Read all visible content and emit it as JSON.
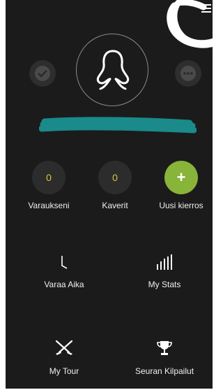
{
  "app": {
    "menu_icon": "hamburger-menu-icon"
  },
  "profile": {
    "left_icon": "check-chat-icon",
    "avatar_icon": "user-silhouette-icon",
    "right_icon": "more-chat-icon",
    "name_redaction": "teal-scribble"
  },
  "counters": [
    {
      "value": "0",
      "label": "Varaukseni"
    },
    {
      "value": "0",
      "label": "Kaverit"
    },
    {
      "value": "+",
      "label": "Uusi kierros"
    }
  ],
  "features": [
    {
      "label": "Varaa Aika",
      "icon": "clock-hand-icon"
    },
    {
      "label": "My Stats",
      "icon": "bar-stats-icon"
    },
    {
      "label": "My Tour",
      "icon": "crossed-clubs-icon"
    },
    {
      "label": "Seuran Kilpailut",
      "icon": "trophy-icon"
    }
  ],
  "colors": {
    "background": "#1b1b1b",
    "accent_green": "#88b43a",
    "counter_value": "#d9c53a",
    "redaction": "#1a8a8a"
  }
}
